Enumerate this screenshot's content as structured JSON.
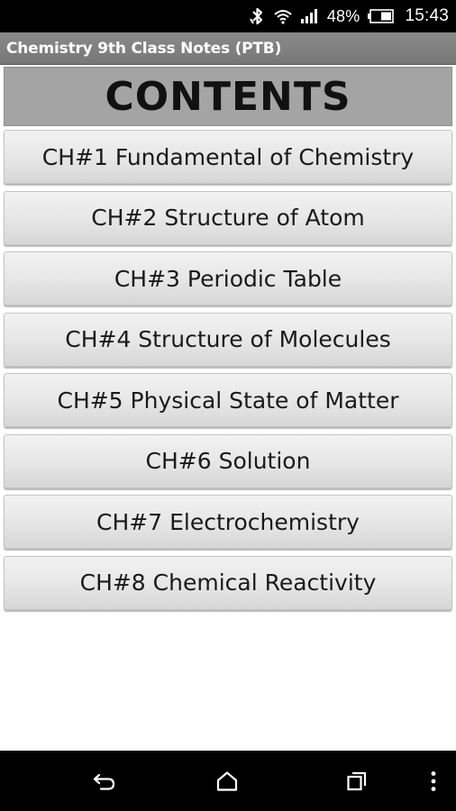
{
  "status_bar": {
    "battery_percent": "48%",
    "time": "15:43",
    "icons": [
      "bluetooth-icon",
      "wifi-icon",
      "signal-icon",
      "battery-icon"
    ]
  },
  "app_bar": {
    "title": "Chemistry 9th Class Notes (PTB)"
  },
  "contents": {
    "heading": "CONTENTS"
  },
  "chapters": [
    {
      "label": "CH#1 Fundamental of Chemistry"
    },
    {
      "label": "CH#2 Structure of Atom"
    },
    {
      "label": "CH#3 Periodic Table"
    },
    {
      "label": "CH#4 Structure of Molecules"
    },
    {
      "label": "CH#5 Physical State of Matter"
    },
    {
      "label": "CH#6 Solution"
    },
    {
      "label": "CH#7 Electrochemistry"
    },
    {
      "label": "CH#8 Chemical Reactivity"
    }
  ],
  "nav_bar": {
    "icons": [
      "back-icon",
      "home-icon",
      "recents-icon",
      "overflow-menu-icon"
    ]
  }
}
